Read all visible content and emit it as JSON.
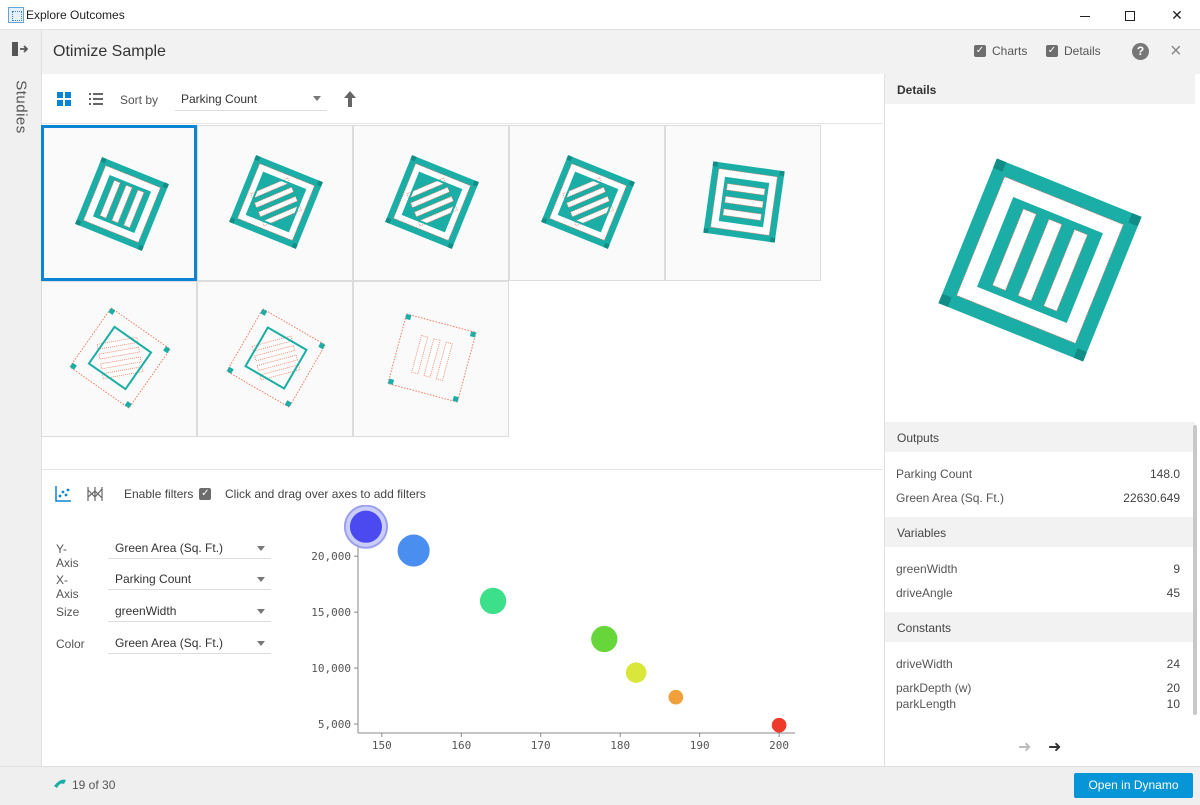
{
  "window": {
    "title": "Explore Outcomes"
  },
  "header": {
    "study_title": "Otimize Sample",
    "charts_label": "Charts",
    "details_label": "Details",
    "help_glyph": "?"
  },
  "sidebar": {
    "studies_label": "Studies"
  },
  "toolbar": {
    "sortby_label": "Sort by",
    "sort_value": "Parking Count"
  },
  "thumbnails": [
    {
      "angle": 22,
      "pattern": "vertical",
      "selected": true
    },
    {
      "angle": 22,
      "pattern": "diag-a",
      "selected": false
    },
    {
      "angle": 22,
      "pattern": "diag-b",
      "selected": false
    },
    {
      "angle": 22,
      "pattern": "diag-c",
      "selected": false
    },
    {
      "angle": 8,
      "pattern": "horizontal",
      "selected": false
    },
    {
      "angle": 35,
      "pattern": "diag-d",
      "selected": false
    },
    {
      "angle": 30,
      "pattern": "diag-e",
      "selected": false
    },
    {
      "angle": 15,
      "pattern": "vertical-light",
      "selected": false
    }
  ],
  "filters": {
    "enable_label": "Enable filters",
    "hint": "Click and drag over axes to add filters"
  },
  "axes": {
    "y_label": "Y-Axis",
    "y_value": "Green Area  (Sq. Ft.)",
    "x_label": "X-Axis",
    "x_value": "Parking Count",
    "size_label": "Size",
    "size_value": "greenWidth",
    "color_label": "Color",
    "color_value": "Green Area  (Sq. Ft.)"
  },
  "chart_data": {
    "type": "scatter",
    "xlim": [
      147,
      202
    ],
    "ylim": [
      4200,
      23500
    ],
    "x_ticks": [
      150,
      160,
      170,
      180,
      190,
      200
    ],
    "y_ticks": [
      5000,
      10000,
      15000,
      20000
    ],
    "x_tick_labels": [
      "150",
      "160",
      "170",
      "180",
      "190",
      "200"
    ],
    "y_tick_labels": [
      "5,000",
      "10,000",
      "15,000",
      "20,000"
    ],
    "points": [
      {
        "x": 148,
        "y": 22630,
        "size": 9,
        "color": "#4a4af0",
        "selected": true
      },
      {
        "x": 154,
        "y": 20500,
        "size": 9,
        "color": "#4a8fef"
      },
      {
        "x": 164,
        "y": 16000,
        "size": 7,
        "color": "#3de08a"
      },
      {
        "x": 178,
        "y": 12600,
        "size": 7,
        "color": "#66d63a"
      },
      {
        "x": 182,
        "y": 9600,
        "size": 5,
        "color": "#d9e63a"
      },
      {
        "x": 187,
        "y": 7400,
        "size": 3,
        "color": "#f2a03a"
      },
      {
        "x": 200,
        "y": 4900,
        "size": 3,
        "color": "#ee3a2a"
      }
    ]
  },
  "details": {
    "header": "Details",
    "outputs_header": "Outputs",
    "outputs": [
      {
        "k": "Parking Count",
        "v": "148.0"
      },
      {
        "k": "Green Area (Sq. Ft.)",
        "v": "22630.649"
      }
    ],
    "variables_header": "Variables",
    "variables": [
      {
        "k": "greenWidth",
        "v": "9"
      },
      {
        "k": "driveAngle",
        "v": "45"
      }
    ],
    "constants_header": "Constants",
    "constants": [
      {
        "k": "driveWidth",
        "v": "24"
      },
      {
        "k": "parkDepth (w)",
        "v": "20"
      },
      {
        "k": "parkLength",
        "v": "10"
      }
    ]
  },
  "footer": {
    "count": "19 of 30",
    "open_button": "Open in Dynamo"
  },
  "colors": {
    "accent": "#0696d7",
    "teal": "#1aaea6",
    "parking": "#f07a5e",
    "select": "#0a84d4"
  }
}
